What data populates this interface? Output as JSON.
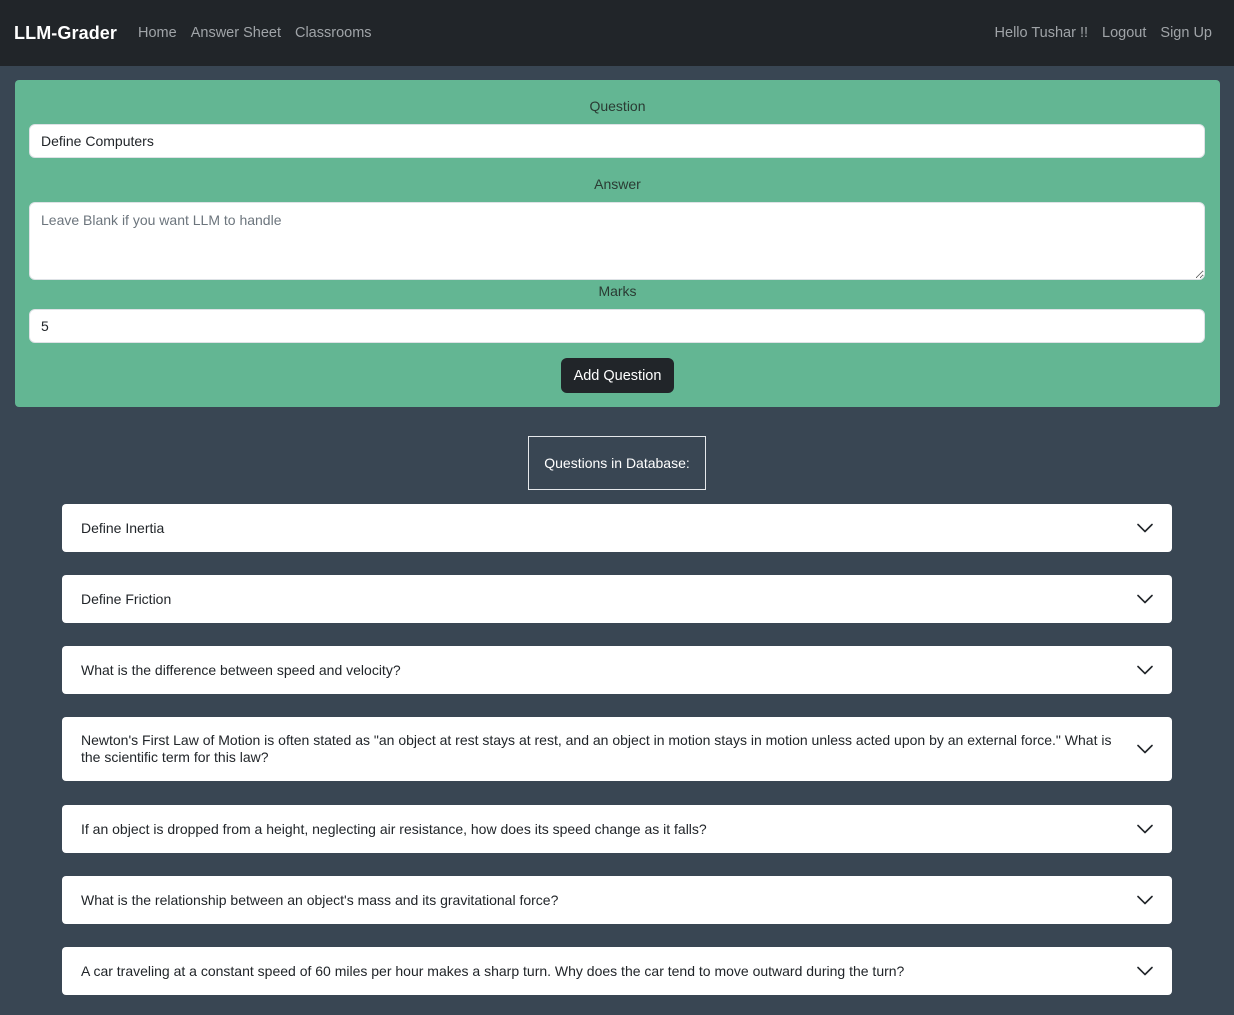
{
  "navbar": {
    "brand": "LLM-Grader",
    "links": [
      "Home",
      "Answer Sheet",
      "Classrooms"
    ],
    "greeting": "Hello Tushar !!",
    "logout": "Logout",
    "signup": "Sign Up"
  },
  "form": {
    "question_label": "Question",
    "question_value": "Define Computers",
    "answer_label": "Answer",
    "answer_placeholder": "Leave Blank if you want LLM to handle",
    "marks_label": "Marks",
    "marks_value": "5",
    "submit_label": "Add Question"
  },
  "questions_header": "Questions in Database:",
  "questions": [
    "Define Inertia",
    "Define Friction",
    "What is the difference between speed and velocity?",
    "Newton's First Law of Motion is often stated as \"an object at rest stays at rest, and an object in motion stays in motion unless acted upon by an external force.\" What is the scientific term for this law?",
    "If an object is dropped from a height, neglecting air resistance, how does its speed change as it falls?",
    "What is the relationship between an object's mass and its gravitational force?",
    "A car traveling at a constant speed of 60 miles per hour makes a sharp turn. Why does the car tend to move outward during the turn?"
  ],
  "colors": {
    "navbar_bg": "#212529",
    "page_bg": "#394653",
    "form_bg": "#63b693",
    "button_bg": "#212529"
  },
  "icons": {
    "accordion_toggle": "chevron-down-icon"
  }
}
